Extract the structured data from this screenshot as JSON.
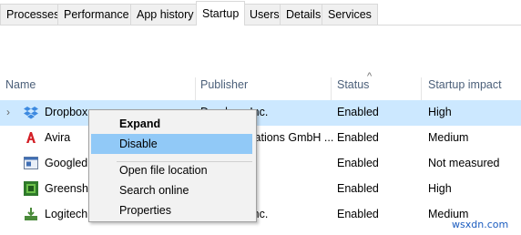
{
  "tabs": [
    {
      "label": "Processes"
    },
    {
      "label": "Performance"
    },
    {
      "label": "App history"
    },
    {
      "label": "Startup"
    },
    {
      "label": "Users"
    },
    {
      "label": "Details"
    },
    {
      "label": "Services"
    }
  ],
  "active_tab": "Startup",
  "columns": {
    "name": "Name",
    "publisher": "Publisher",
    "status": "Status",
    "impact": "Startup impact",
    "sort_arrow": "^"
  },
  "rows": [
    {
      "name": "Dropbox",
      "publisher": "Dropbox, Inc.",
      "status": "Enabled",
      "impact": "High",
      "icon": "dropbox-icon"
    },
    {
      "name": "Avira",
      "publisher": "Avira Operations GmbH ...",
      "status": "Enabled",
      "impact": "Medium",
      "icon": "avira-icon"
    },
    {
      "name": "Googledr",
      "publisher": "",
      "status": "Enabled",
      "impact": "Not measured",
      "icon": "google-drive-icon"
    },
    {
      "name": "Greenshot",
      "publisher": "",
      "status": "Enabled",
      "impact": "High",
      "icon": "greenshot-icon"
    },
    {
      "name": "Logitech",
      "publisher": "Logitech, Inc.",
      "status": "Enabled",
      "impact": "Medium",
      "icon": "logitech-icon"
    }
  ],
  "context_menu": {
    "items": [
      {
        "label": "Expand"
      },
      {
        "label": "Disable"
      },
      {
        "label": "Open file location"
      },
      {
        "label": "Search online"
      },
      {
        "label": "Properties"
      }
    ]
  },
  "watermark": "wsxdn.com",
  "colors": {
    "selected_row": "#cce8ff",
    "menu_highlight": "#91c9f7",
    "header_text": "#4c607a"
  }
}
